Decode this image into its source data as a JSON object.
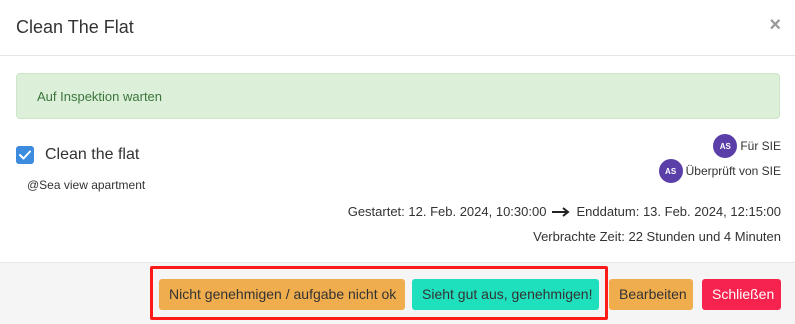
{
  "modal": {
    "title": "Clean The Flat",
    "close_glyph": "×"
  },
  "alert": {
    "text": "Auf Inspektion warten"
  },
  "task": {
    "checked": true,
    "title": "Clean the flat",
    "location": "@Sea view apartment"
  },
  "assignees": [
    {
      "initials": "AS",
      "label": "Für SIE"
    },
    {
      "initials": "AS",
      "label": "Überprüft von SIE"
    }
  ],
  "dates": {
    "started": "Gestartet: 12. Feb. 2024, 10:30:00",
    "end": "Enddatum: 13. Feb. 2024, 12:15:00",
    "spent": "Verbrachte Zeit: 22 Stunden und 4 Minuten"
  },
  "footer": {
    "reject_label": "Nicht genehmigen / aufgabe nicht ok",
    "approve_label": "Sieht gut aus, genehmigen!",
    "edit_label": "Bearbeiten",
    "close_label": "Schließen"
  },
  "colors": {
    "alert_bg": "#dcefd8",
    "alert_text": "#3c763d",
    "checkbox": "#3c8bde",
    "avatar": "#5a3fa8",
    "warning_button": "#f0ad4e",
    "approve_button": "#1fe0bd",
    "danger_button": "#f5234e",
    "highlight_box": "#ff1a1a"
  },
  "icons": {
    "checkbox": "checkmark-icon",
    "arrow": "arrow-right-icon",
    "close": "close-icon"
  }
}
